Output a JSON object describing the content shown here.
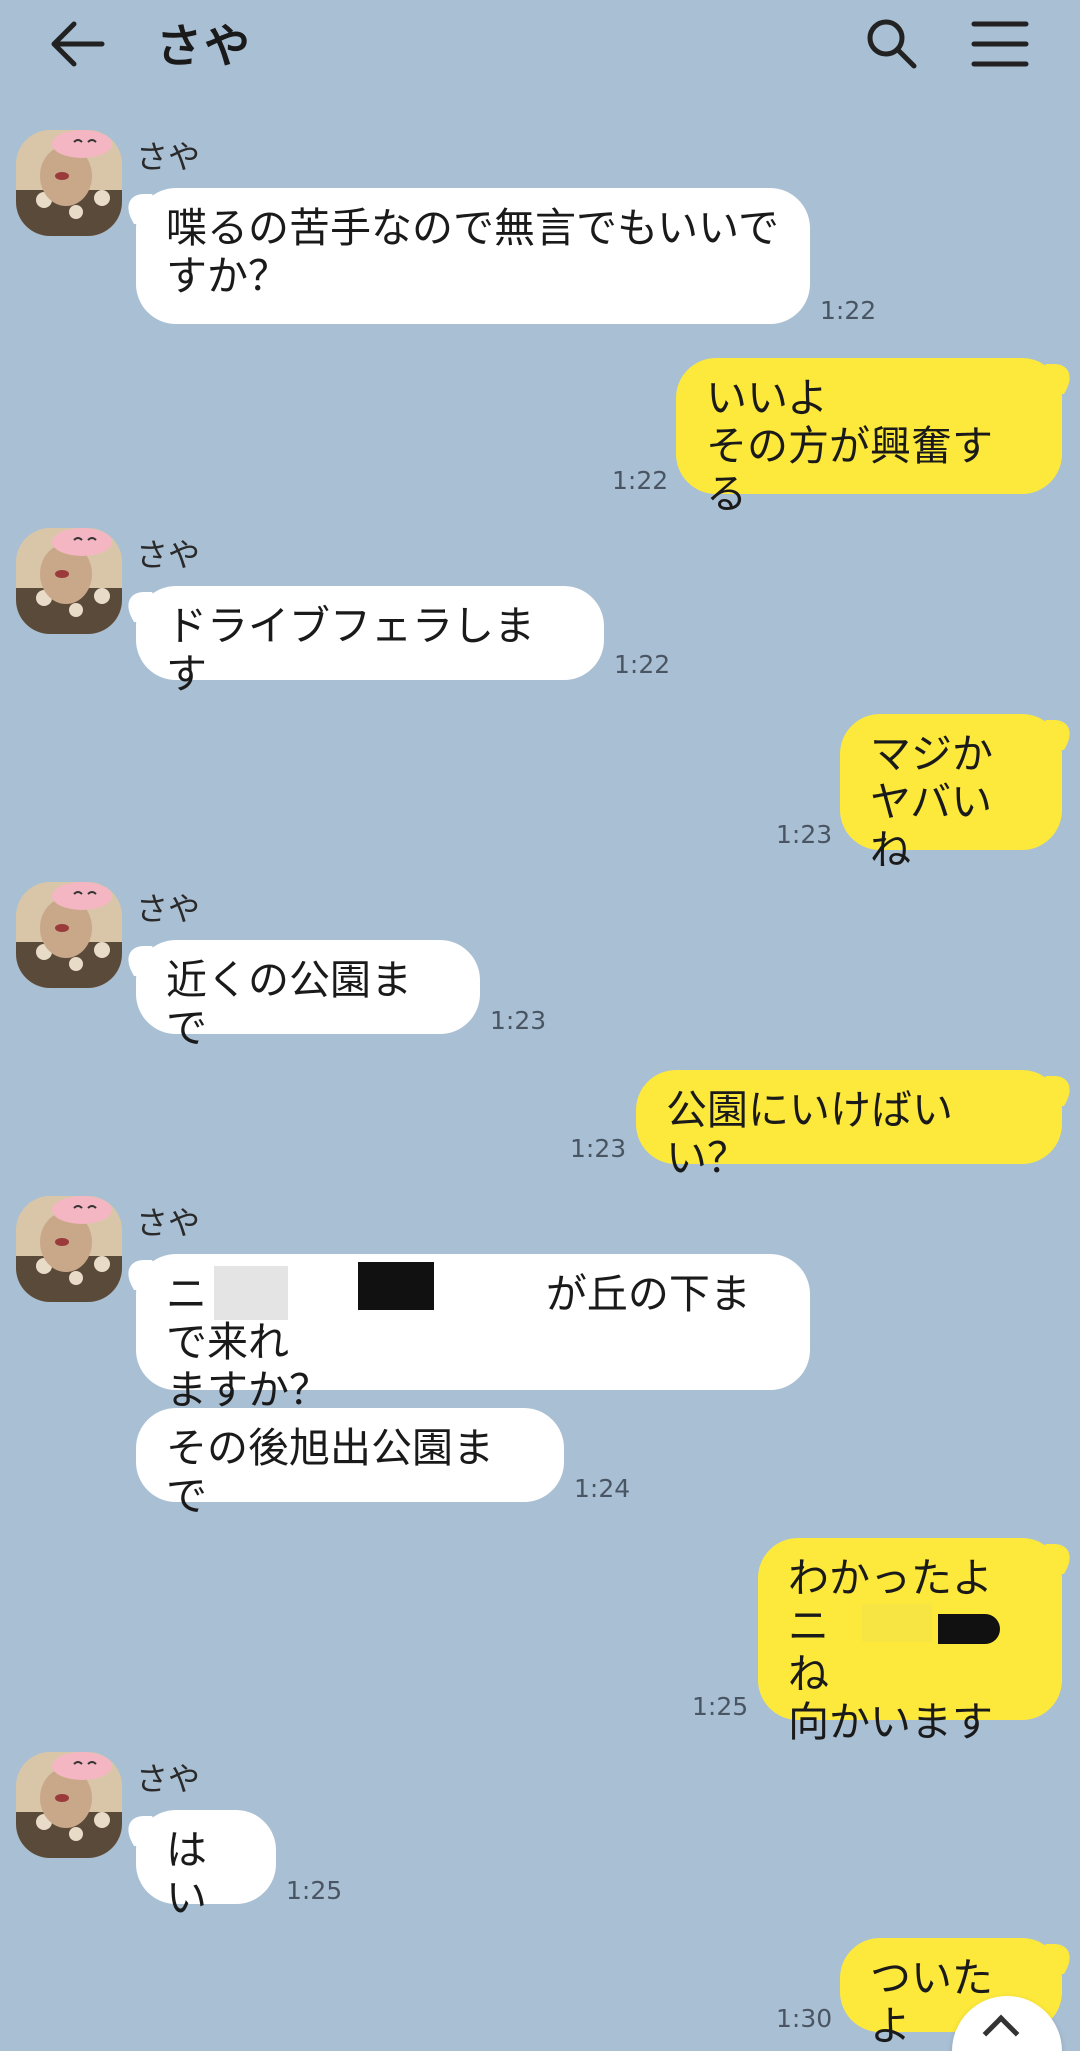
{
  "header": {
    "title": "さや",
    "back_icon": "back-arrow-icon",
    "search_icon": "search-icon",
    "menu_icon": "hamburger-menu-icon"
  },
  "colors": {
    "background": "#a9bfd4",
    "incoming_bubble": "#ffffff",
    "outgoing_bubble": "#fde93b"
  },
  "messages": [
    {
      "sender": "さや",
      "text": "喋るの苦手なので無言でもいいで\nすか？",
      "time": "1:22"
    },
    {
      "sender": "me",
      "text": "いいよ\nその方が興奮する",
      "time": "1:22"
    },
    {
      "sender": "さや",
      "text": "ドライブフェラします",
      "time": "1:22"
    },
    {
      "sender": "me",
      "text": "マジか\nヤバいね",
      "time": "1:23"
    },
    {
      "sender": "さや",
      "text": "近くの公園まで",
      "time": "1:23"
    },
    {
      "sender": "me",
      "text": "公園にいけばいい？",
      "time": "1:23"
    },
    {
      "sender": "さや",
      "text": "ニ                          が丘の下まで来れ\nますか？",
      "time": ""
    },
    {
      "sender": "さや",
      "text": "その後旭出公園まで",
      "time": "1:24"
    },
    {
      "sender": "me",
      "text": "わかったよ\nニ                  ね\n向かいます",
      "time": "1:25"
    },
    {
      "sender": "さや",
      "text": "はい",
      "time": "1:25"
    },
    {
      "sender": "me",
      "text": "ついたよ",
      "time": "1:30"
    }
  ],
  "scroll_button_icon": "chevron-up-icon"
}
